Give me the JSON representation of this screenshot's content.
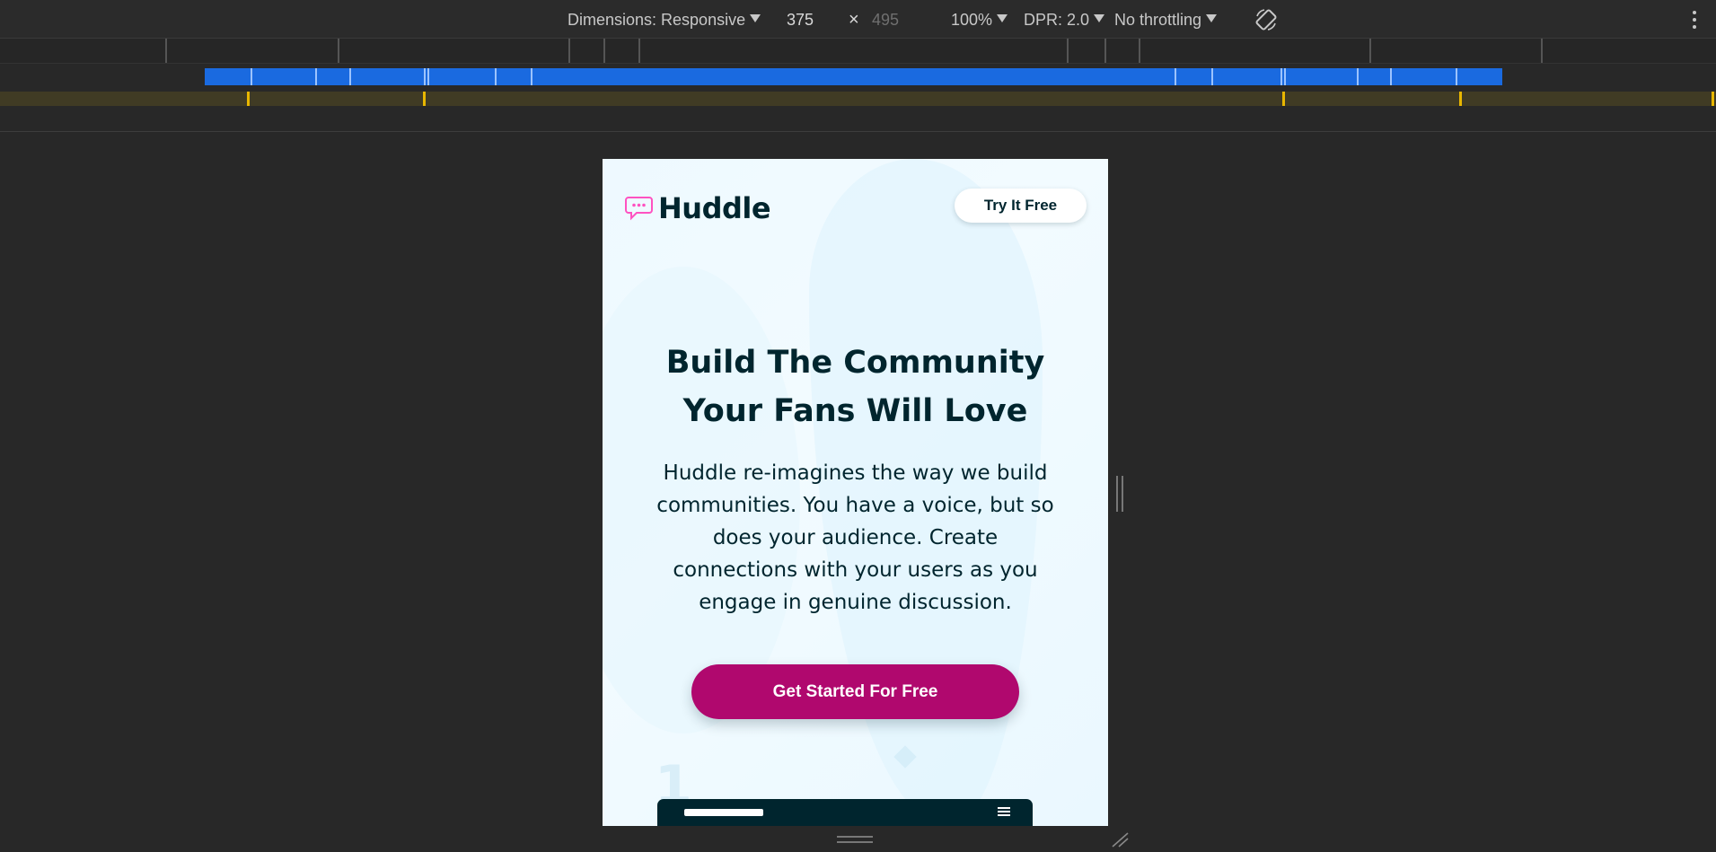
{
  "devtools": {
    "dimensions_label": "Dimensions: Responsive",
    "width_value": "375",
    "height_placeholder": "495",
    "times_symbol": "×",
    "zoom": "100%",
    "dpr": "DPR: 2.0",
    "throttling": "No throttling",
    "rotate_icon": "rotate-icon",
    "more_icon": "more-options-icon"
  },
  "page": {
    "logo_text": "Huddle",
    "try_button": "Try It Free",
    "title_line1": "Build The Community",
    "title_line2": "Your Fans Will Love",
    "description": "Huddle re-imagines the way we build communities. You have a voice, but so does your audience. Create connections with your users as you engage in genuine discussion.",
    "cta_button": "Get Started For Free",
    "deco_number": "1"
  },
  "colors": {
    "brand_dark": "#00252e",
    "brand_magenta": "#b0086e",
    "logo_pink": "#ff52c1",
    "page_bg": "#eef9ff",
    "devtools_bg": "#282828",
    "media_query_blue": "#1a6ae0",
    "media_query_marker": "#e8b600"
  }
}
